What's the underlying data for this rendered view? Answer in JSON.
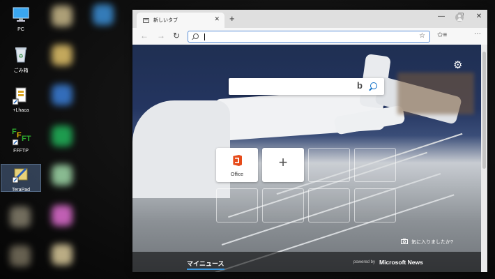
{
  "desktop": {
    "icons": [
      {
        "label": "PC",
        "icon": "pc-icon"
      },
      {
        "label": "ごみ箱",
        "icon": "recycle-bin-icon"
      },
      {
        "label": "+Lhaca",
        "icon": "lhaca-icon"
      },
      {
        "label": "FFFTP",
        "icon": "ffftp-icon"
      },
      {
        "label": "TeraPad",
        "icon": "terapad-icon"
      }
    ]
  },
  "browser": {
    "tab": {
      "title": "新しいタブ",
      "close": "✕"
    },
    "new_tab": "+",
    "window_controls": {
      "minimize": "—",
      "maximize": "☐",
      "close": "✕"
    },
    "nav": {
      "back": "←",
      "forward": "→",
      "refresh": "↻"
    },
    "address": {
      "value": "",
      "favorite": "☆"
    },
    "toolbar": {
      "collections": "✩≡",
      "more": "···"
    },
    "page": {
      "settings": "⚙",
      "search": {
        "value": "",
        "logo": "b"
      },
      "tiles": [
        {
          "label": "Office",
          "type": "office"
        },
        {
          "label": "",
          "type": "add",
          "symbol": "+"
        }
      ],
      "like_image": "気に入りましたか?",
      "news_tab": "マイニュース",
      "powered_by": "powered by",
      "news_brand": "Microsoft News"
    },
    "accent_color": "#3a96dd"
  }
}
